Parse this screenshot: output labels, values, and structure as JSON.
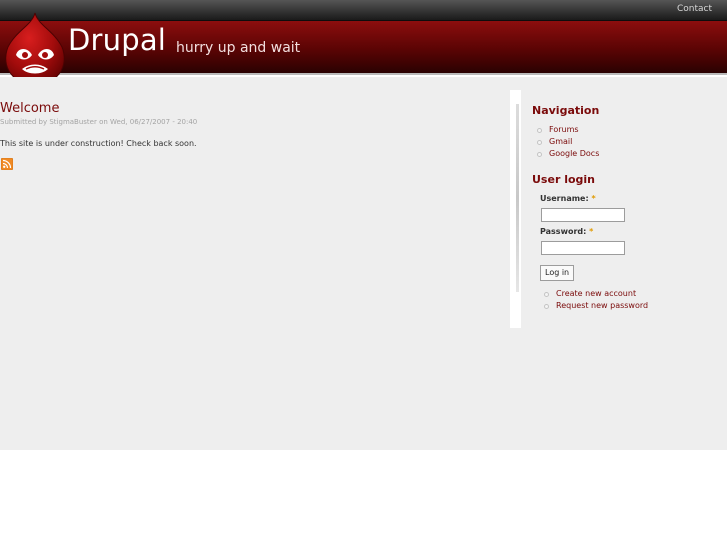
{
  "topbar": {
    "contact_label": "Contact"
  },
  "header": {
    "site_name": "Drupal",
    "slogan": "hurry up and wait",
    "logo_icon": "drupal-drop-icon"
  },
  "content": {
    "node_title": "Welcome",
    "submitted": "Submitted by StigmaBuster on Wed, 06/27/2007 - 20:40",
    "body": "This site is under construction! Check back soon.",
    "feed_icon": "rss-feed-icon"
  },
  "sidebar": {
    "navigation": {
      "title": "Navigation",
      "items": [
        {
          "label": "Forums"
        },
        {
          "label": "Gmail"
        },
        {
          "label": "Google Docs"
        }
      ]
    },
    "user_login": {
      "title": "User login",
      "username_label": "Username:",
      "password_label": "Password:",
      "required_mark": "*",
      "username_value": "",
      "password_value": "",
      "login_button": "Log in",
      "links": [
        {
          "label": "Create new account"
        },
        {
          "label": "Request new password"
        }
      ]
    }
  },
  "colors": {
    "header_red": "#5a0404",
    "link_red": "#7a0a0a",
    "main_bg": "#eeeeee",
    "required_orange": "#e09a00"
  }
}
